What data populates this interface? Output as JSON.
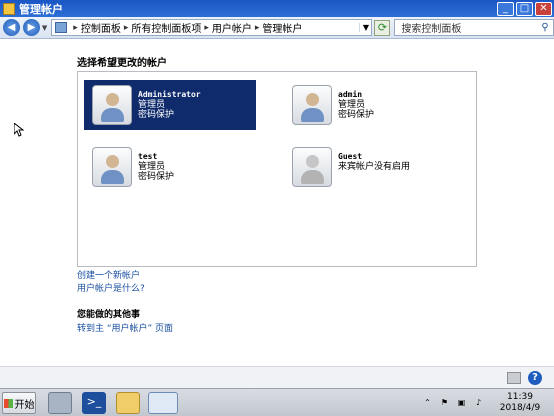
{
  "window": {
    "title": "管理帐户",
    "controls": {
      "minimize": "_",
      "maximize": "□",
      "close": "✕"
    }
  },
  "address": {
    "crumbs": [
      "控制面板",
      "所有控制面板项",
      "用户帐户",
      "管理帐户"
    ],
    "search_placeholder": "搜索控制面板"
  },
  "main": {
    "heading": "选择希望更改的帐户",
    "accounts": [
      {
        "name": "Administrator",
        "role": "管理员",
        "status": "密码保护",
        "selected": true
      },
      {
        "name": "admin",
        "role": "管理员",
        "status": "密码保护",
        "selected": false
      },
      {
        "name": "test",
        "role": "管理员",
        "status": "密码保护",
        "selected": false
      },
      {
        "name": "Guest",
        "role": "来宾帐户没有启用",
        "status": "",
        "selected": false
      }
    ],
    "links": {
      "create_account": "创建一个新帐户",
      "what_is_account": "用户帐户是什么?"
    },
    "other_heading": "您能做的其他事",
    "goto_main": "转到主 “用户帐户” 页面"
  },
  "taskbar": {
    "start_label": "开始",
    "clock_time": "11:39",
    "clock_date": "2018/4/9"
  },
  "colors": {
    "selected_bg": "#0f2b6b",
    "link": "#1a4fa0",
    "titlebar": "#1a56c4"
  }
}
